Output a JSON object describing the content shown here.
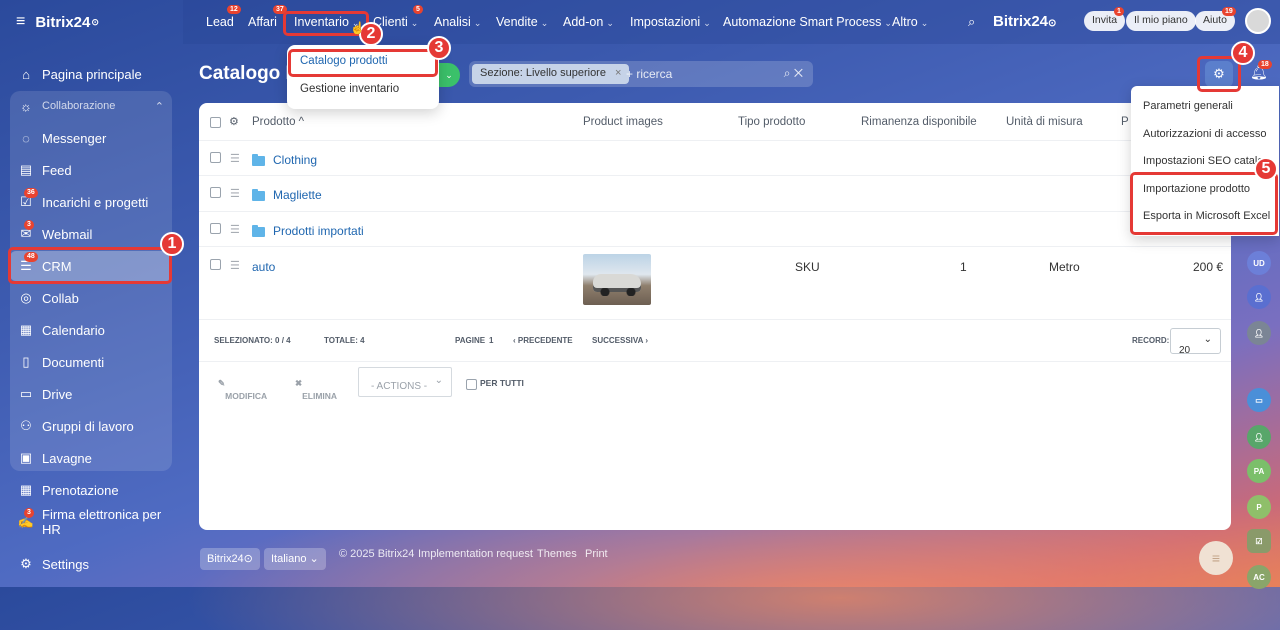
{
  "brand": {
    "name": "Bitrix24",
    "mark": "⊙"
  },
  "sidebar": {
    "items": [
      {
        "label": "Pagina principale",
        "icon": "home-icon"
      },
      {
        "label": "Collaborazione",
        "icon": "collab-section-icon"
      },
      {
        "label": "Messenger",
        "icon": "messenger-icon"
      },
      {
        "label": "Feed",
        "icon": "feed-icon"
      },
      {
        "label": "Incarichi e progetti",
        "icon": "tasks-icon",
        "badge": "36"
      },
      {
        "label": "Webmail",
        "icon": "mail-icon",
        "badge": "3"
      },
      {
        "label": "CRM",
        "icon": "crm-icon",
        "badge": "48"
      },
      {
        "label": "Collab",
        "icon": "collab-icon"
      },
      {
        "label": "Calendario",
        "icon": "calendar-icon"
      },
      {
        "label": "Documenti",
        "icon": "documents-icon"
      },
      {
        "label": "Drive",
        "icon": "drive-icon"
      },
      {
        "label": "Gruppi di lavoro",
        "icon": "groups-icon"
      },
      {
        "label": "Lavagne",
        "icon": "boards-icon"
      },
      {
        "label": "Prenotazione",
        "icon": "booking-icon"
      },
      {
        "label": "Firma elettronica per HR",
        "icon": "esign-icon",
        "badge": "3"
      },
      {
        "label": "Settings",
        "icon": "settings-icon"
      }
    ]
  },
  "topnav": {
    "items": [
      {
        "label": "Lead",
        "badge": "12"
      },
      {
        "label": "Affari",
        "badge": "37"
      },
      {
        "label": "Inventario",
        "chev": "⌄"
      },
      {
        "label": "Clienti",
        "badge": "5",
        "chev": "⌄"
      },
      {
        "label": "Analisi",
        "chev": "⌄"
      },
      {
        "label": "Vendite",
        "chev": "⌄"
      },
      {
        "label": "Add-on",
        "chev": "⌄"
      },
      {
        "label": "Impostazioni",
        "chev": "⌄"
      },
      {
        "label": "Automazione Smart Process",
        "chev": "⌄"
      },
      {
        "label": "Altro",
        "chev": "⌄"
      }
    ],
    "invite": "Invita",
    "invite_badge": "1",
    "plan": "Il mio piano",
    "help": "Aiuto",
    "help_badge": "19"
  },
  "page": {
    "title": "Catalogo I",
    "filter_tag": "Sezione: Livello superiore",
    "filter_placeholder": "+ ricerca",
    "bell_badge": "18"
  },
  "inventory_menu": [
    "Catalogo prodotti",
    "Gestione inventario"
  ],
  "settings_menu": [
    "Parametri generali",
    "Autorizzazioni di accesso",
    "Impostazioni SEO catalo",
    "Importazione prodotto",
    "Esporta in Microsoft Excel"
  ],
  "table": {
    "columns": [
      "Prodotto ^",
      "Product images",
      "Tipo prodotto",
      "Rimanenza disponibile",
      "Unità di misura",
      "P"
    ],
    "rows": [
      {
        "name": "Clothing",
        "folder": true
      },
      {
        "name": "Magliette",
        "folder": true
      },
      {
        "name": "Prodotti importati",
        "folder": true
      },
      {
        "name": "auto",
        "folder": false,
        "type": "SKU",
        "stock": "1",
        "unit": "Metro",
        "price": "200 €"
      }
    ],
    "footer": {
      "selected": "SELEZIONATO: 0 / 4",
      "total": "TOTALE: 4",
      "pages": "PAGINE",
      "page_num": "1",
      "prev": "‹ PRECEDENTE",
      "next": "SUCCESSIVA ›",
      "records_label": "RECORD:",
      "records_value": "20"
    },
    "actions": {
      "edit": "MODIFICA",
      "delete": "ELIMINA",
      "select": "- ACTIONS -",
      "all": "PER TUTTI"
    }
  },
  "right_rail": [
    {
      "initials": "UD",
      "color": "#6c7fd8"
    },
    {
      "initials": "",
      "color": "#5a6fd0"
    },
    {
      "initials": "",
      "color": "#7b8595"
    },
    {
      "initials": "",
      "color": "#4a8fd8"
    },
    {
      "initials": "",
      "color": "#58a66a"
    },
    {
      "initials": "PA",
      "color": "#7bbf6a"
    },
    {
      "initials": "P",
      "color": "#8fbf6a"
    },
    {
      "initials": "",
      "color": "#8a9a6a"
    },
    {
      "initials": "AC",
      "color": "#8aa56a"
    }
  ],
  "footer": {
    "brand": "Bitrix24⊙",
    "lang": "Italiano ⌄",
    "copy": "© 2025 Bitrix24",
    "impl": "Implementation request",
    "themes": "Themes",
    "print": "Print"
  },
  "annotations": [
    "1",
    "2",
    "3",
    "4",
    "5"
  ]
}
